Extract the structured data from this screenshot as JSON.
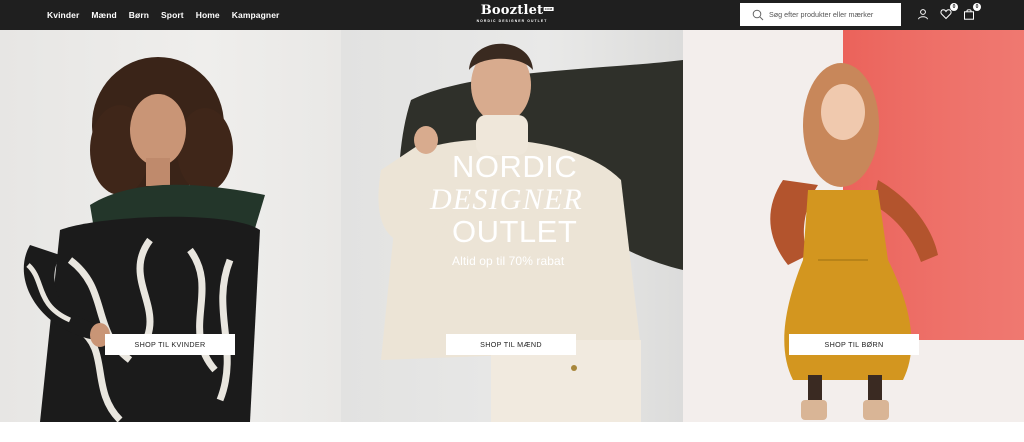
{
  "nav": {
    "items": [
      "Kvinder",
      "Mænd",
      "Børn",
      "Sport",
      "Home",
      "Kampagner"
    ]
  },
  "logo": {
    "name": "Booztlet",
    "superscript": "COM",
    "tagline": "NORDIC DESIGNER OUTLET"
  },
  "search": {
    "placeholder": "Søg efter produkter eller mærker",
    "icon": "search-icon"
  },
  "header_icons": {
    "account": "user-icon",
    "wishlist": "heart-icon",
    "wishlist_count": "0",
    "cart": "bag-icon",
    "cart_count": "0"
  },
  "hero": {
    "headline_line1": "NORDIC",
    "headline_line2": "DESIGNER",
    "headline_line3": "OUTLET",
    "subheadline": "Altid op til 70% rabat",
    "panels": [
      {
        "button": "SHOP TIL KVINDER"
      },
      {
        "button": "SHOP TIL MÆND"
      },
      {
        "button": "SHOP TIL BØRN"
      }
    ]
  },
  "colors": {
    "topbar": "#1f1f1f",
    "text_light": "#ffffff",
    "kids_backdrop": "#ef6f66"
  }
}
